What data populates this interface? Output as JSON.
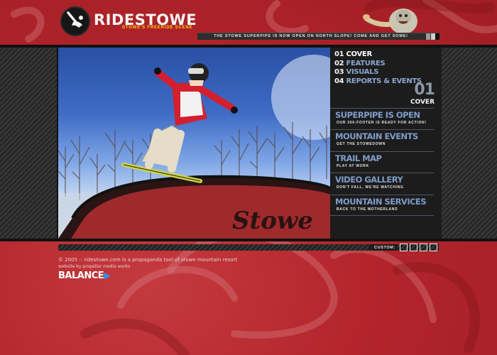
{
  "header": {
    "logo_text": "RIDESTOWE",
    "tagline": "STOWE'S FREERIDE SCENE",
    "ticker": "THE STOWE SUPERPIPE IS NOW OPEN ON NORTH SLOPE! COME AND GET SOME!"
  },
  "toc": [
    {
      "num": "01",
      "label": "COVER"
    },
    {
      "num": "02",
      "label": "FEATURES"
    },
    {
      "num": "03",
      "label": "VISUALS"
    },
    {
      "num": "04",
      "label": "REPORTS & EVENTS"
    }
  ],
  "current_section": {
    "num": "01",
    "name": "COVER"
  },
  "menu": [
    {
      "title": "SUPERPIPE IS OPEN",
      "sub": "OUR 300-FOOTER IS READY FOR ACTION!"
    },
    {
      "title": "MOUNTAIN EVENTS",
      "sub": "GET THE STOWEDOWN"
    },
    {
      "title": "TRAIL MAP",
      "sub": "PLAY AT WORK"
    },
    {
      "title": "VIDEO GALLERY",
      "sub": "DON'T FALL, WE'RE WATCHING"
    },
    {
      "title": "MOUNTAIN SERVICES",
      "sub": "BACK TO THE MOTHERLAND"
    }
  ],
  "hero": {
    "rail_logo": "Stowe"
  },
  "custom": {
    "label": "CUSTOM:",
    "boxes": 4
  },
  "footer": {
    "copyright": "© 2005 :: ridestowe.com is a propaganda tool of stowe mountain resort",
    "credit": "website by propeller media works",
    "brand": "BALANCE"
  },
  "colors": {
    "background_red": "#b8252b",
    "menu_blue": "#7f9cc9",
    "tagline_yellow": "#ffd21a"
  }
}
